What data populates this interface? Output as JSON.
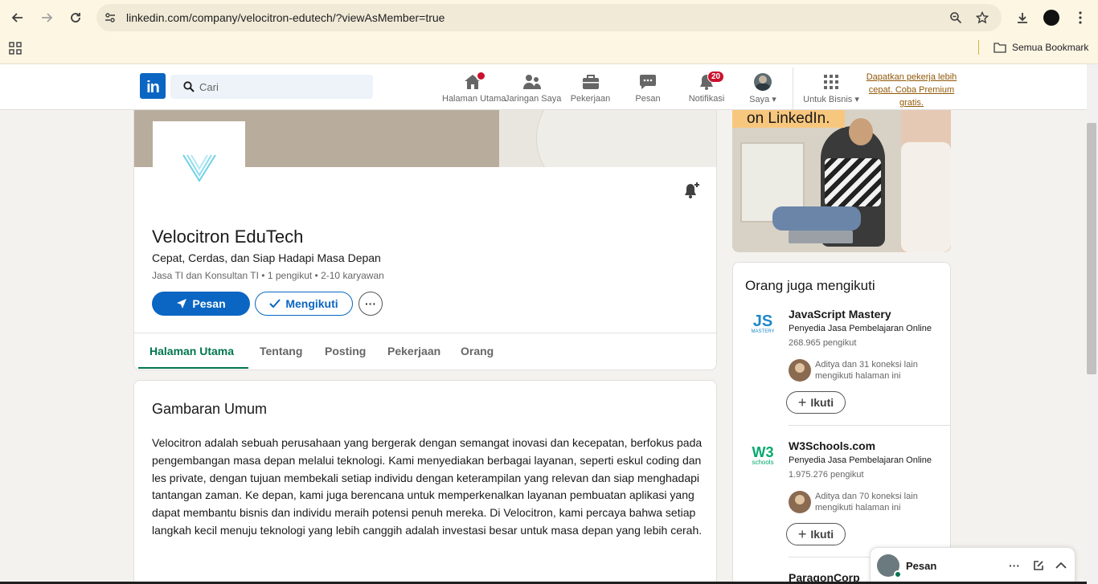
{
  "browser": {
    "url": "linkedin.com/company/velocitron-edutech/?viewAsMember=true",
    "bookmarks_folder": "Semua Bookmark"
  },
  "nav": {
    "logo": "in",
    "search_placeholder": "Cari",
    "items": [
      {
        "label": "Halaman Utama",
        "icon": "home-icon"
      },
      {
        "label": "Jaringan Saya",
        "icon": "people-icon"
      },
      {
        "label": "Pekerjaan",
        "icon": "briefcase-icon"
      },
      {
        "label": "Pesan",
        "icon": "chat-icon"
      },
      {
        "label": "Notifikasi",
        "icon": "bell-icon",
        "badge": "20"
      },
      {
        "label": "Saya",
        "icon": "avatar"
      },
      {
        "label": "Untuk Bisnis",
        "icon": "grid-icon"
      }
    ],
    "premium_link": "Dapatkan pekerja lebih cepat. Coba Premium gratis."
  },
  "company": {
    "name": "Velocitron EduTech",
    "tagline": "Cepat, Cerdas, dan Siap Hadapi Masa Depan",
    "meta": "Jasa TI dan Konsultan TI • 1 pengikut • 2-10 karyawan",
    "message_button": "Pesan",
    "following_button": "Mengikuti",
    "tabs": [
      "Halaman Utama",
      "Tentang",
      "Posting",
      "Pekerjaan",
      "Orang"
    ],
    "active_tab": "Halaman Utama"
  },
  "overview": {
    "title": "Gambaran Umum",
    "body": "Velocitron adalah sebuah perusahaan yang bergerak dengan semangat inovasi dan kecepatan, berfokus pada pengembangan masa depan melalui teknologi. Kami menyediakan berbagai layanan, seperti eskul coding dan les private, dengan tujuan membekali setiap individu dengan keterampilan yang relevan dan siap menghadapi tantangan zaman. Ke depan, kami juga berencana untuk memperkenalkan layanan pembuatan aplikasi yang dapat membantu bisnis dan individu meraih potensi penuh mereka. Di Velocitron, kami percaya bahwa setiap langkah kecil menuju teknologi yang lebih canggih adalah investasi besar untuk masa depan yang lebih cerah."
  },
  "ad": {
    "caption": "on LinkedIn."
  },
  "also_follow": {
    "title": "Orang juga mengikuti",
    "items": [
      {
        "name": "JavaScript Mastery",
        "category": "Penyedia Jasa Pembelajaran Online",
        "followers": "268.965 pengikut",
        "connections": "Aditya dan 31 koneksi lain mengikuti halaman ini",
        "button": "Ikuti",
        "logo_text": "JS",
        "logo_sub": "MASTERY"
      },
      {
        "name": "W3Schools.com",
        "category": "Penyedia Jasa Pembelajaran Online",
        "followers": "1.975.276 pengikut",
        "connections": "Aditya dan 70 koneksi lain mengikuti halaman ini",
        "button": "Ikuti",
        "logo_text": "W3",
        "logo_sub": "schools"
      },
      {
        "name": "ParagonCorp"
      }
    ]
  },
  "messaging": {
    "label": "Pesan"
  },
  "colors": {
    "linkedin_blue": "#0a66c2",
    "active_tab_green": "#01754f",
    "notification_red": "#cb112d",
    "premium_gold": "#915907"
  }
}
